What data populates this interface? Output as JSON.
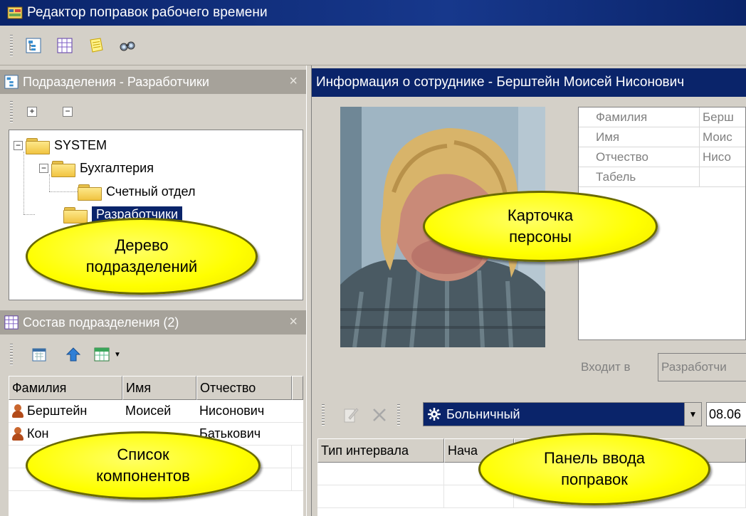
{
  "window": {
    "title": "Редактор поправок рабочего времени"
  },
  "toolbar": {
    "icons": [
      "tree-view-icon",
      "grid-view-icon",
      "notes-icon",
      "binoculars-icon"
    ]
  },
  "departments_panel": {
    "title": "Подразделения - Разработчики",
    "close": "×",
    "expand": "+",
    "collapse": "−",
    "tree": [
      {
        "label": "SYSTEM",
        "level": 0
      },
      {
        "label": "Бухгалтерия",
        "level": 1
      },
      {
        "label": "Счетный отдел",
        "level": 2
      },
      {
        "label": "Разработчики",
        "level": 1,
        "selected": true
      }
    ]
  },
  "members_panel": {
    "title": "Состав подразделения (2)",
    "close": "×",
    "columns": [
      "Фамилия",
      "Имя",
      "Отчество"
    ],
    "rows": [
      {
        "last": "Берштейн",
        "first": "Моисей",
        "middle": "Нисонович"
      },
      {
        "last": "Кон",
        "first": "",
        "middle": "Батькович"
      }
    ]
  },
  "employee_panel": {
    "title": "Информация о сотруднике - Берштейн Моисей Нисонович",
    "fields": [
      {
        "label": "Фамилия",
        "value": "Берш"
      },
      {
        "label": "Имя",
        "value": "Моис"
      },
      {
        "label": "Отчество",
        "value": "Нисо"
      },
      {
        "label": "Табель",
        "value": ""
      }
    ],
    "inclusion_label": "Входит в",
    "inclusion_value": "Разработчи"
  },
  "corrections_panel": {
    "type_value": "Больничный",
    "date_value": "08.06",
    "columns": [
      "Тип интервала",
      "Нача"
    ]
  },
  "callouts": {
    "tree": "Дерево\nподразделений",
    "card": "Карточка\nперсоны",
    "list": "Список\nкомпонентов",
    "input": "Панель ввода\nпоправок"
  },
  "colors": {
    "title_bar": "#0a246a",
    "selection": "#0a246a",
    "callout": "#ffff00",
    "panel_inactive": "#a6a29a"
  }
}
